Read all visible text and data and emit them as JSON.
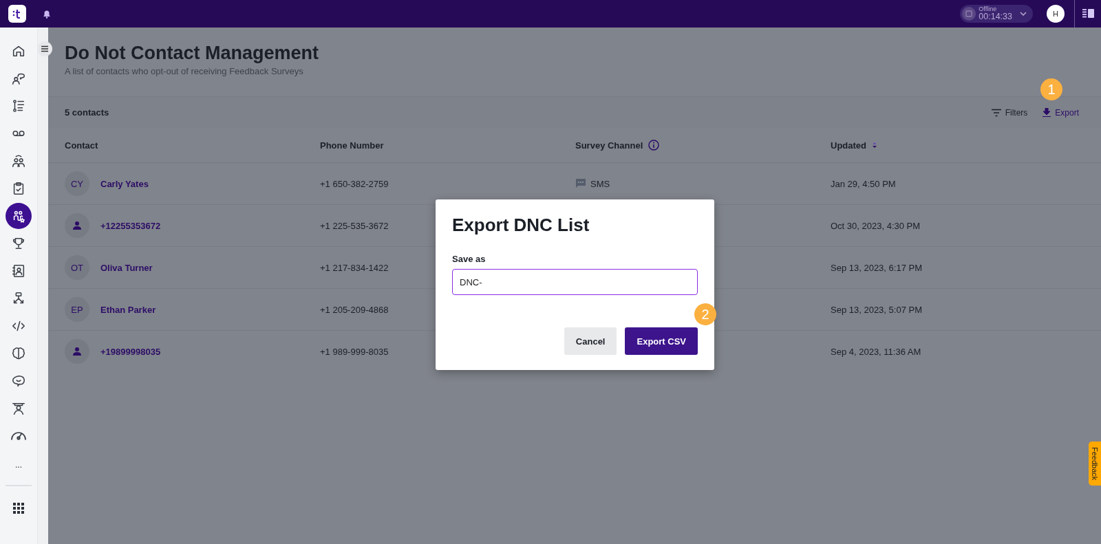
{
  "topbar": {
    "status": {
      "label": "Offline",
      "timer": "00:14:33"
    },
    "avatar": "H"
  },
  "sidebar": {
    "items": [
      {
        "selected": false
      },
      {
        "selected": false
      },
      {
        "selected": false
      },
      {
        "selected": false
      },
      {
        "selected": false
      },
      {
        "selected": false
      },
      {
        "selected": true
      },
      {
        "selected": false
      },
      {
        "selected": false
      },
      {
        "selected": false
      },
      {
        "selected": false
      },
      {
        "selected": false
      },
      {
        "selected": false
      },
      {
        "selected": false
      },
      {
        "selected": false
      }
    ],
    "more": "..."
  },
  "page": {
    "title": "Do Not Contact Management",
    "subtitle": "A list of contacts who opt-out of receiving Feedback Surveys",
    "count": "5 contacts",
    "actions": [
      {
        "label": "Filters",
        "kind": "filter"
      },
      {
        "label": "Export",
        "kind": "export"
      }
    ],
    "step_badge": "1",
    "table": {
      "columns": [
        {
          "label": "Contact",
          "info": false,
          "sorted": false
        },
        {
          "label": "Phone Number",
          "info": false,
          "sorted": false
        },
        {
          "label": "Survey Channel",
          "info": true,
          "sorted": false
        },
        {
          "label": "Updated",
          "info": false,
          "sorted": true
        }
      ],
      "rows": [
        {
          "avatar": {
            "kind": "initials",
            "text": "CY"
          },
          "name": "Carly Yates",
          "phone": "+1 650-382-2759",
          "channel": "SMS",
          "updated": "Jan 29, 4:50 PM"
        },
        {
          "avatar": {
            "kind": "person"
          },
          "name": "+12255353672",
          "phone": "+1 225-535-3672",
          "updated": "Oct 30, 2023, 4:30 PM"
        },
        {
          "avatar": {
            "kind": "initials",
            "text": "OT"
          },
          "name": "Oliva Turner",
          "phone": "+1 217-834-1422",
          "updated": "Sep 13, 2023, 6:17 PM"
        },
        {
          "avatar": {
            "kind": "initials",
            "text": "EP"
          },
          "name": "Ethan Parker",
          "phone": "+1 205-209-4868",
          "updated": "Sep 13, 2023, 5:07 PM"
        },
        {
          "avatar": {
            "kind": "person"
          },
          "name": "+19899998035",
          "phone": "+1 989-999-8035",
          "updated": "Sep 4, 2023, 11:36 AM"
        }
      ]
    }
  },
  "dialog": {
    "title": "Export DNC List",
    "field": {
      "label": "Save as",
      "value": "DNC-",
      "focused": true
    },
    "buttons": [
      {
        "label": "Cancel",
        "kind": "secondary"
      },
      {
        "label": "Export CSV",
        "kind": "primary"
      }
    ],
    "step_badge": "2"
  },
  "feedback_tab": "Feedback"
}
